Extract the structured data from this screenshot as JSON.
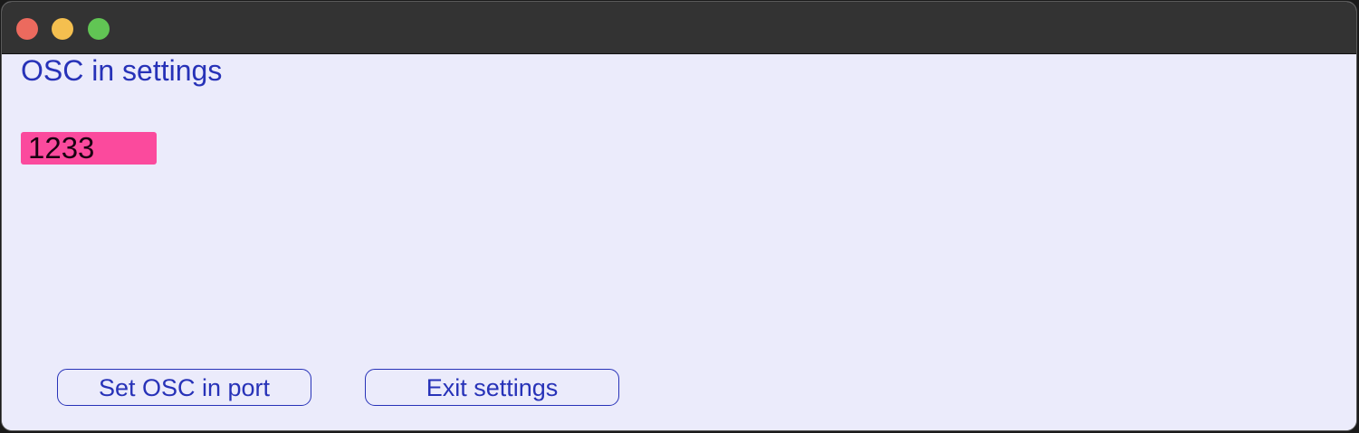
{
  "window": {
    "controls": [
      "close-icon",
      "minimize-icon",
      "zoom-icon"
    ],
    "colors": {
      "titlebar": "#333333",
      "background": "#ebebfb",
      "accent_text": "#2732b8",
      "field_background": "#fb4a9d"
    }
  },
  "settings": {
    "title": "OSC in settings",
    "port_value": "1233",
    "set_port_label": "Set OSC in port",
    "exit_label": "Exit settings"
  }
}
